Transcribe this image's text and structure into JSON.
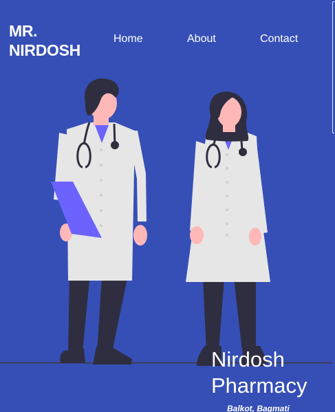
{
  "header": {
    "brand_line1": "MR.",
    "brand_line2": "NIRDOSH",
    "nav": {
      "home": "Home",
      "about": "About",
      "contact": "Contact"
    }
  },
  "hero": {
    "title_line1": "Nirdosh",
    "title_line2": "Pharmacy",
    "subtitle": "Balkot, Bagmati"
  },
  "colors": {
    "background": "#364fb6",
    "accent_purple": "#6c63ff",
    "coat": "#e6e6e6",
    "skin": "#ffb8b8",
    "hair": "#2f2e41"
  }
}
